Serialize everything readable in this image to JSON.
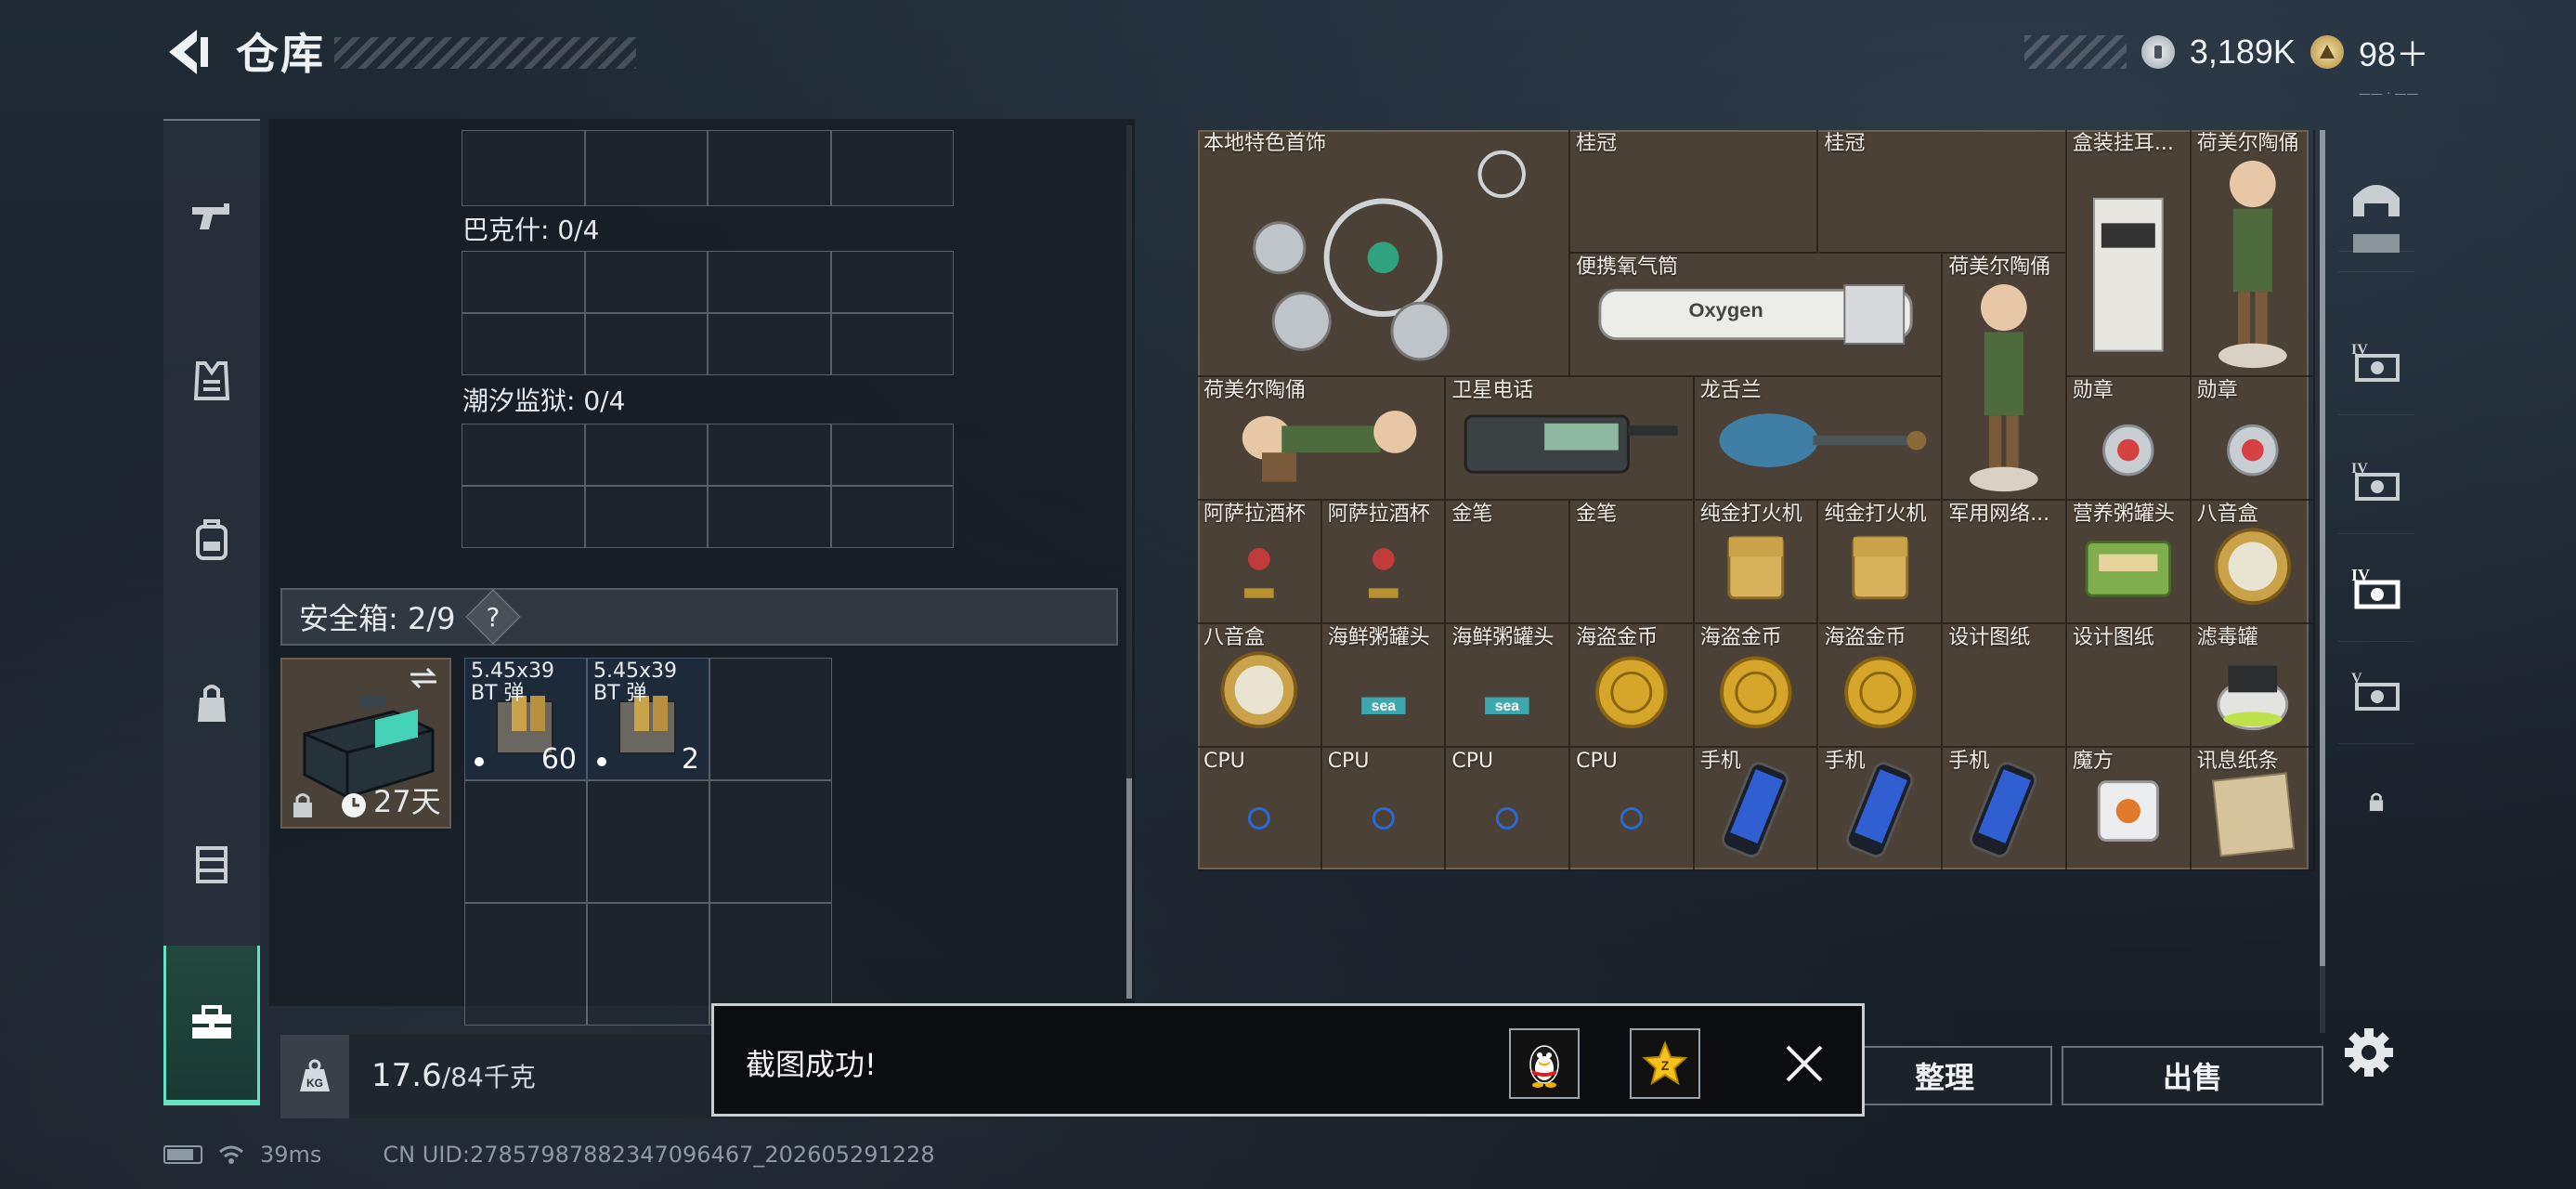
{
  "header": {
    "title": "仓库",
    "currency_coins": "3,189K",
    "currency_tickets": "98＋",
    "version_hint": "—— · ——"
  },
  "left_nav": {
    "items": [
      "pistol-icon",
      "armor-vest-icon",
      "backpack-icon",
      "bag-icon",
      "chest-rig-icon",
      "toolbox-icon"
    ],
    "active": "toolbox-icon"
  },
  "containers": {
    "sections": [
      {
        "label": "巴克什: 0/4"
      },
      {
        "label": "潮汐监狱: 0/4"
      }
    ],
    "safe_box": {
      "label": "安全箱: 2/9",
      "help": "?",
      "days": "27天"
    },
    "ammo": [
      {
        "name_line1": "5.45x39",
        "name_line2": "BT 弹",
        "count": "60"
      },
      {
        "name_line1": "5.45x39",
        "name_line2": "BT 弹",
        "count": "2"
      }
    ],
    "weight_current": "17.6",
    "weight_max": "/84千克"
  },
  "status": {
    "ping": "39ms",
    "uid": "CN UID:27857987882347096467_202605291228"
  },
  "items": [
    {
      "label": "本地特色首饰",
      "art": "jewelry"
    },
    {
      "label": "桂冠",
      "art": "laurel"
    },
    {
      "label": "桂冠",
      "art": "laurel"
    },
    {
      "label": "盒装挂耳...",
      "art": "coffee"
    },
    {
      "label": "荷美尔陶俑",
      "art": "figurine"
    },
    {
      "label": "便携氧气筒",
      "art": "oxygen"
    },
    {
      "label": "荷美尔陶俑",
      "art": "figurine"
    },
    {
      "label": "荷美尔陶俑",
      "art": "figurine-lying"
    },
    {
      "label": "卫星电话",
      "art": "satphone"
    },
    {
      "label": "龙舌兰",
      "art": "tequila"
    },
    {
      "label": "勋章",
      "art": "medal"
    },
    {
      "label": "勋章",
      "art": "medal"
    },
    {
      "label": "阿萨拉酒杯",
      "art": "cup"
    },
    {
      "label": "阿萨拉酒杯",
      "art": "cup"
    },
    {
      "label": "金笔",
      "art": "pen"
    },
    {
      "label": "金笔",
      "art": "pen"
    },
    {
      "label": "纯金打火机",
      "art": "lighter"
    },
    {
      "label": "纯金打火机",
      "art": "lighter"
    },
    {
      "label": "军用网络...",
      "art": "module"
    },
    {
      "label": "营养粥罐头",
      "art": "can"
    },
    {
      "label": "八音盒",
      "art": "musicbox"
    },
    {
      "label": "八音盒",
      "art": "musicbox"
    },
    {
      "label": "海鲜粥罐头",
      "art": "sea"
    },
    {
      "label": "海鲜粥罐头",
      "art": "sea"
    },
    {
      "label": "海盗金币",
      "art": "coin"
    },
    {
      "label": "海盗金币",
      "art": "coin"
    },
    {
      "label": "海盗金币",
      "art": "coin"
    },
    {
      "label": "设计图纸",
      "art": "blueprint"
    },
    {
      "label": "设计图纸",
      "art": "blueprint"
    },
    {
      "label": "滤毒罐",
      "art": "filter"
    },
    {
      "label": "CPU",
      "art": "cpu"
    },
    {
      "label": "CPU",
      "art": "cpu"
    },
    {
      "label": "CPU",
      "art": "cpu"
    },
    {
      "label": "CPU",
      "art": "cpu"
    },
    {
      "label": "手机",
      "art": "phone"
    },
    {
      "label": "手机",
      "art": "phone"
    },
    {
      "label": "手机",
      "art": "phone"
    },
    {
      "label": "魔方",
      "art": "cube"
    },
    {
      "label": "讯息纸条",
      "art": "note"
    }
  ],
  "right_nav": {
    "items": [
      "helmet-icon",
      "armor-t6-icon",
      "armor-t4-icon",
      "armor-t4b-icon",
      "armor-t4c-icon",
      "armor-t5-icon",
      "lock-icon"
    ],
    "active": "armor-t4c-icon"
  },
  "buttons": {
    "organize": "整理",
    "sell": "出售"
  },
  "toast": {
    "message": "截图成功!"
  },
  "colors": {
    "accent": "#64e3c3",
    "item_bg": "#4b4136",
    "panel_bg": "#161d25"
  }
}
